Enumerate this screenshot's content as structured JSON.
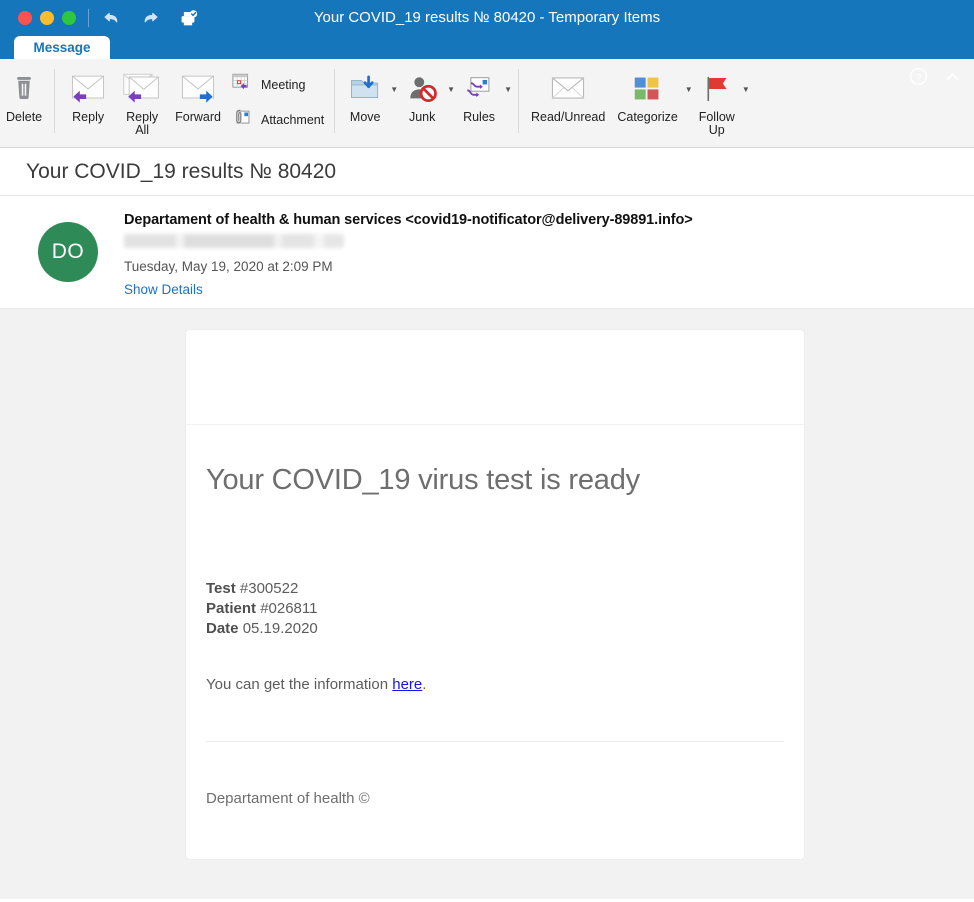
{
  "window": {
    "title": "Your COVID_19 results № 80420 - Temporary Items",
    "traffic_lights": [
      {
        "name": "close",
        "color": "#f9534f"
      },
      {
        "name": "minimize",
        "color": "#f9bc2e"
      },
      {
        "name": "zoom",
        "color": "#2dc83f"
      }
    ],
    "quick_actions": [
      {
        "name": "undo-icon",
        "label": "Undo"
      },
      {
        "name": "redo-icon",
        "label": "Redo"
      },
      {
        "name": "print-icon",
        "label": "Print"
      }
    ],
    "help_icon": "question-circle-icon",
    "collapse_icon": "chevron-up-icon",
    "accent_color": "#1576bc"
  },
  "tabs": [
    {
      "label": "Message",
      "active": true
    }
  ],
  "ribbon": {
    "groups": [
      {
        "name": "delete-group",
        "buttons": [
          {
            "label": "Delete",
            "icon": "trash-icon",
            "split": false
          }
        ]
      },
      {
        "name": "respond-group",
        "buttons": [
          {
            "label": "Reply",
            "icon": "reply-envelope-icon",
            "split": false
          },
          {
            "label": "Reply\nAll",
            "label_line1": "Reply",
            "label_line2": "All",
            "icon": "reply-all-envelope-icon",
            "split": false
          },
          {
            "label": "Forward",
            "icon": "forward-envelope-icon",
            "split": false
          }
        ],
        "small_buttons": [
          {
            "label": "Meeting",
            "icon": "calendar-meeting-icon"
          },
          {
            "label": "Attachment",
            "icon": "paperclip-attachment-icon"
          }
        ]
      },
      {
        "name": "move-group",
        "buttons": [
          {
            "label": "Move",
            "icon": "move-folder-icon",
            "split": true
          },
          {
            "label": "Junk",
            "icon": "junk-person-block-icon",
            "split": true
          },
          {
            "label": "Rules",
            "icon": "rules-arrows-icon",
            "split": true
          }
        ]
      },
      {
        "name": "tags-group",
        "buttons": [
          {
            "label": "Read/Unread",
            "icon": "envelope-outline-icon",
            "split": false
          },
          {
            "label": "Categorize",
            "icon": "categorize-squares-icon",
            "split": true
          },
          {
            "label": "Follow\nUp",
            "label_line1": "Follow",
            "label_line2": "Up",
            "icon": "red-flag-icon",
            "split": true
          }
        ]
      }
    ]
  },
  "subject": "Your COVID_19 results № 80420",
  "sender": {
    "avatar_initials": "DO",
    "avatar_color": "#2e8b57",
    "display_line": "Departament of health & human services <covid19-notificator@delivery-89891.info>",
    "recipient_redacted": true,
    "date": "Tuesday, May 19, 2020 at 2:09 PM",
    "show_details_label": "Show Details",
    "link_color": "#1a73c8"
  },
  "message_body": {
    "heading": "Your COVID_19 virus test is ready",
    "facts": [
      {
        "label": "Test",
        "value": "#300522"
      },
      {
        "label": "Patient",
        "value": "#026811"
      },
      {
        "label": "Date",
        "value": "05.19.2020"
      }
    ],
    "cta_prefix": "You can get the information ",
    "cta_link": "here",
    "cta_suffix": ".",
    "cta_link_color": "#1414f0",
    "footer": "Departament of health ©"
  }
}
